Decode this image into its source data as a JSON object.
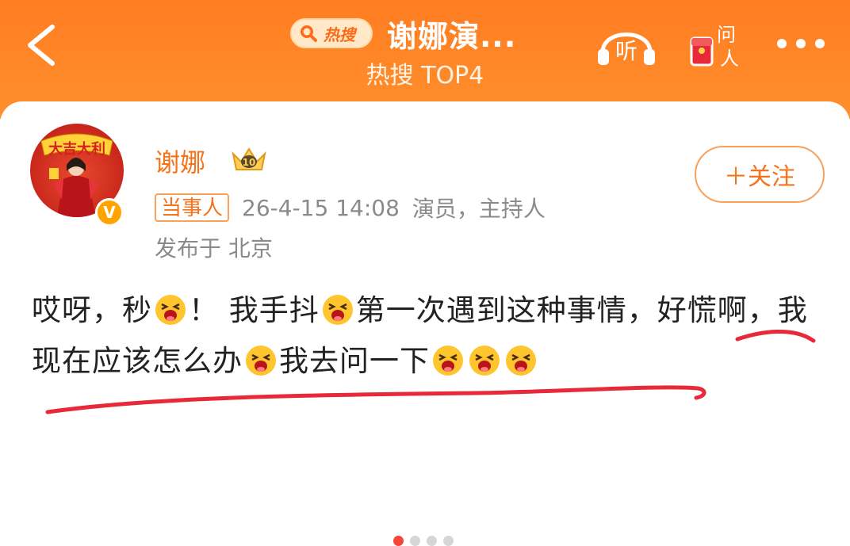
{
  "header": {
    "hot_tag": "热搜",
    "title": "谢娜演...",
    "subtitle": "热搜 TOP4",
    "listen_label": "听",
    "ask_label_top": "问",
    "ask_label_bottom": "人"
  },
  "post": {
    "author": "谢娜",
    "avatar_text": "大吉大利",
    "crown_level": "10",
    "verify_badge": "V",
    "party_tag": "当事人",
    "timestamp": "26-4-15 14:08",
    "occupation": "演员，主持人",
    "location": "发布于 北京",
    "follow_label": "＋关注",
    "segments": [
      "哎呀，秒",
      "！ 我手抖",
      "第一次遇到这种事情，好慌啊，我现在应该怎么办",
      "我去问一下"
    ]
  },
  "pagination": {
    "count": 4,
    "active": 1
  },
  "colors": {
    "accent": "#f5731b",
    "header": "#ff7d22",
    "underline": "#e8293a"
  }
}
